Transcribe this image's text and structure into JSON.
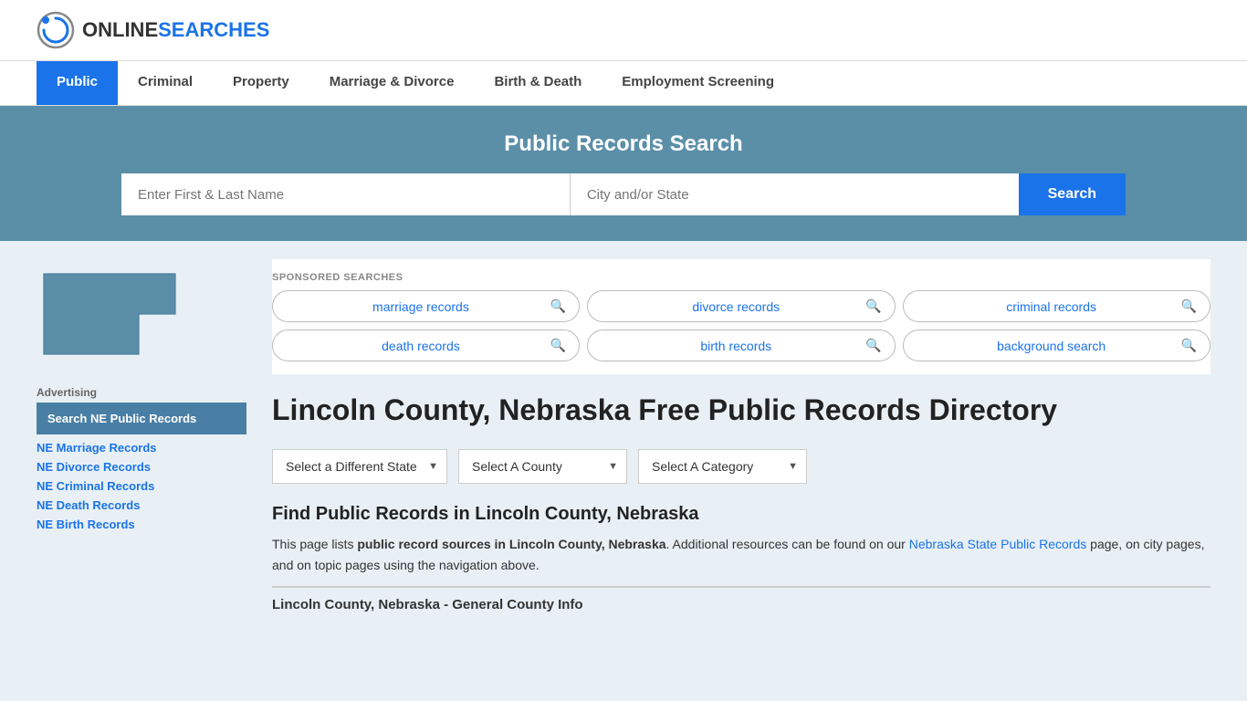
{
  "header": {
    "logo_online": "ONLINE",
    "logo_searches": "SEARCHES"
  },
  "nav": {
    "items": [
      {
        "label": "Public",
        "active": true
      },
      {
        "label": "Criminal",
        "active": false
      },
      {
        "label": "Property",
        "active": false
      },
      {
        "label": "Marriage & Divorce",
        "active": false
      },
      {
        "label": "Birth & Death",
        "active": false
      },
      {
        "label": "Employment Screening",
        "active": false
      }
    ]
  },
  "hero": {
    "title": "Public Records Search",
    "name_placeholder": "Enter First & Last Name",
    "location_placeholder": "City and/or State",
    "search_label": "Search"
  },
  "sponsored": {
    "label": "SPONSORED SEARCHES",
    "items": [
      {
        "text": "marriage records"
      },
      {
        "text": "divorce records"
      },
      {
        "text": "criminal records"
      },
      {
        "text": "death records"
      },
      {
        "text": "birth records"
      },
      {
        "text": "background search"
      }
    ]
  },
  "page": {
    "title": "Lincoln County, Nebraska Free Public Records Directory",
    "state_select_label": "Select a Different State",
    "county_select_label": "Select A County",
    "category_select_label": "Select A Category",
    "find_title": "Find Public Records in Lincoln County, Nebraska",
    "find_text_part1": "This page lists ",
    "find_text_bold": "public record sources in Lincoln County, Nebraska",
    "find_text_part2": ". Additional resources can be found on our ",
    "find_link_text": "Nebraska State Public Records",
    "find_text_part3": " page, on city pages, and on topic pages using the navigation above.",
    "general_info_title": "Lincoln County, Nebraska - General County Info"
  },
  "sidebar": {
    "ad_label": "Advertising",
    "ad_box_text": "Search NE Public Records",
    "links": [
      {
        "label": "NE Marriage Records"
      },
      {
        "label": "NE Divorce Records"
      },
      {
        "label": "NE Criminal Records"
      },
      {
        "label": "NE Death Records"
      },
      {
        "label": "NE Birth Records"
      }
    ]
  }
}
